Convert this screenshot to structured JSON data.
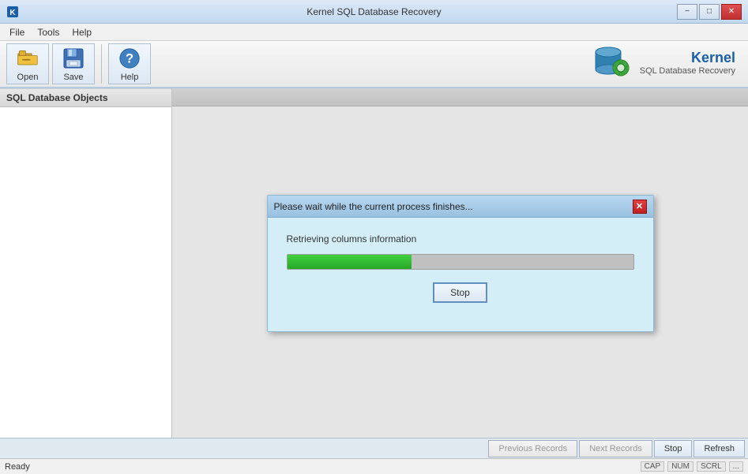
{
  "window": {
    "title": "Kernel SQL Database Recovery",
    "controls": {
      "minimize": "−",
      "maximize": "□",
      "close": "✕"
    }
  },
  "menu": {
    "items": [
      "File",
      "Tools",
      "Help"
    ]
  },
  "toolbar": {
    "buttons": [
      {
        "id": "open",
        "label": "Open"
      },
      {
        "id": "save",
        "label": "Save"
      },
      {
        "id": "help",
        "label": "Help"
      }
    ]
  },
  "logo": {
    "brand": "Kernel",
    "subtitle": "SQL Database Recovery"
  },
  "left_panel": {
    "header": "SQL Database Objects"
  },
  "bottom_bar": {
    "previous_label": "Previous Records",
    "next_label": "Next Records",
    "stop_label": "Stop",
    "refresh_label": "Refresh"
  },
  "status_bar": {
    "status": "Ready",
    "indicators": [
      "CAP",
      "NUM",
      "SCRL",
      "..."
    ]
  },
  "modal": {
    "title": "Please wait while the current process finishes...",
    "status_text": "Retrieving columns information",
    "progress_percent": 36,
    "stop_button": "Stop"
  }
}
